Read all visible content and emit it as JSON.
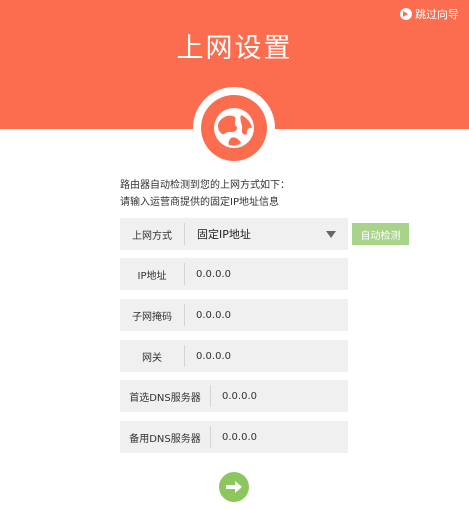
{
  "header": {
    "title": "上网设置",
    "skip_label": "跳过向导"
  },
  "instructions": {
    "line1": "路由器自动检测到您的上网方式如下：",
    "line2": "请输入运营商提供的固定IP地址信息"
  },
  "form": {
    "connection_type": {
      "label": "上网方式",
      "value": "固定IP地址"
    },
    "detect_button": "自动检测",
    "ip": {
      "label": "IP地址",
      "value": "0.0.0.0"
    },
    "subnet": {
      "label": "子网掩码",
      "value": "0.0.0.0"
    },
    "gateway": {
      "label": "网关",
      "value": "0.0.0.0"
    },
    "primary_dns": {
      "label": "首选DNS服务器",
      "value": "0.0.0.0"
    },
    "secondary_dns": {
      "label": "备用DNS服务器",
      "value": "0.0.0.0"
    }
  },
  "icons": {
    "skip": "skip-arrow-icon",
    "globe": "globe-icon",
    "dropdown": "chevron-down-icon",
    "next": "arrow-right-icon"
  },
  "colors": {
    "header_bg": "#fc6c4f",
    "field_bg": "#f0f0f0",
    "detect_btn": "#a7d38b",
    "next_btn": "#8dc65d"
  }
}
